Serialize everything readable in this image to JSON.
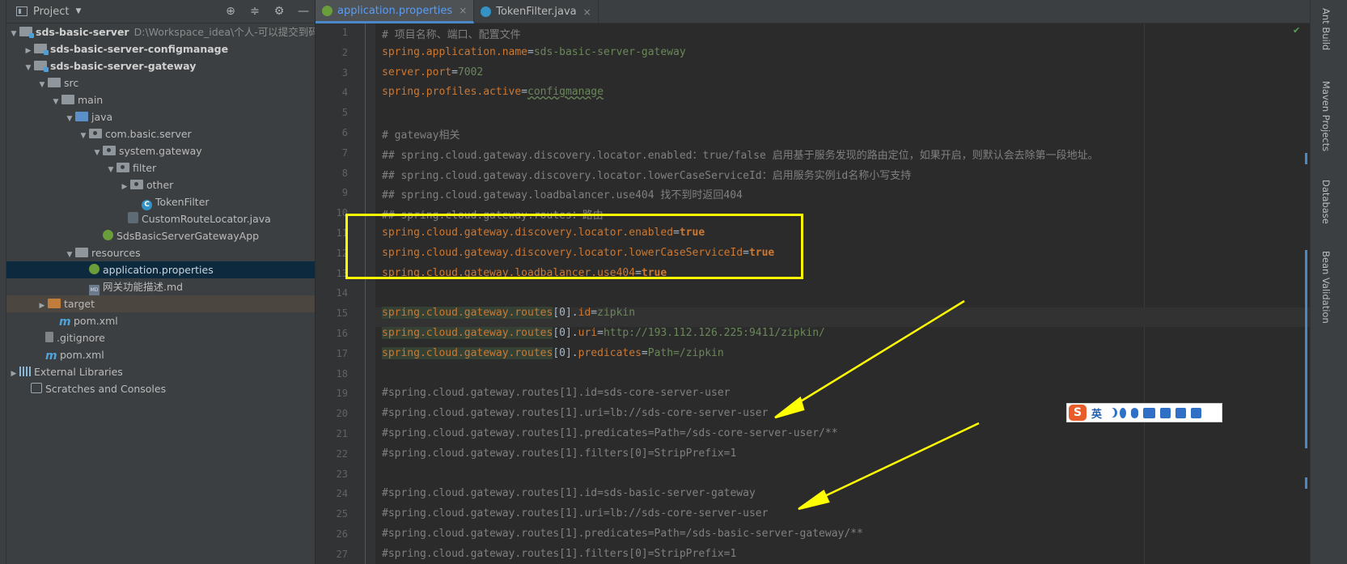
{
  "project_panel": {
    "title": "Project",
    "tree": [
      {
        "label": "sds-basic-server",
        "hint": "D:\\Workspace_idea\\个人-可以提交到码云的"
      },
      {
        "label": "sds-basic-server-configmanage"
      },
      {
        "label": "sds-basic-server-gateway"
      },
      {
        "label": "src"
      },
      {
        "label": "main"
      },
      {
        "label": "java"
      },
      {
        "label": "com.basic.server"
      },
      {
        "label": "system.gateway"
      },
      {
        "label": "filter"
      },
      {
        "label": "other"
      },
      {
        "label": "TokenFilter"
      },
      {
        "label": "CustomRouteLocator.java"
      },
      {
        "label": "SdsBasicServerGatewayApp"
      },
      {
        "label": "resources"
      },
      {
        "label": "application.properties"
      },
      {
        "label": "网关功能描述.md"
      },
      {
        "label": "target"
      },
      {
        "label": "pom.xml"
      },
      {
        "label": ".gitignore"
      },
      {
        "label": "pom.xml"
      },
      {
        "label": "External Libraries"
      },
      {
        "label": "Scratches and Consoles"
      }
    ]
  },
  "tabs": [
    {
      "label": "application.properties",
      "close": "×"
    },
    {
      "label": "TokenFilter.java",
      "close": "×"
    }
  ],
  "editor": {
    "line_numbers": [
      "1",
      "2",
      "3",
      "4",
      "5",
      "6",
      "7",
      "8",
      "9",
      "10",
      "11",
      "12",
      "13",
      "14",
      "15",
      "16",
      "17",
      "18",
      "19",
      "20",
      "21",
      "22",
      "23",
      "24",
      "25",
      "26",
      "27"
    ],
    "lines": [
      {
        "text": "# 项目名称、端口、配置文件"
      },
      {
        "key": "spring.application.name",
        "eq": "=",
        "val": "sds-basic-server-gateway"
      },
      {
        "key": "server.port",
        "eq": "=",
        "val": "7002"
      },
      {
        "key": "spring.profiles.active",
        "eq": "=",
        "val": "configmanage"
      },
      {
        "text": ""
      },
      {
        "text": "# gateway相关"
      },
      {
        "text": "## spring.cloud.gateway.discovery.locator.enabled：true/false 启用基于服务发现的路由定位，如果开启，则默认会去除第一段地址。"
      },
      {
        "text": "## spring.cloud.gateway.discovery.locator.lowerCaseServiceId：启用服务实例id名称小写支持"
      },
      {
        "text": "## spring.cloud.gateway.loadbalancer.use404 找不到时返回404"
      },
      {
        "text": "## spring.cloud.gateway.routes：路由"
      },
      {
        "key": "spring.cloud.gateway.discovery.locator.enabled",
        "eq": "=",
        "val": "true"
      },
      {
        "key": "spring.cloud.gateway.discovery.locator.lowerCaseServiceId",
        "eq": "=",
        "val": "true"
      },
      {
        "key": "spring.cloud.gateway.loadbalancer.use404",
        "eq": "=",
        "val": "true"
      },
      {
        "text": ""
      },
      {
        "key": "spring.cloud.gateway.routes",
        "idx": "[0].",
        "prop": "id",
        "eq": "=",
        "val": "zipkin"
      },
      {
        "key": "spring.cloud.gateway.routes",
        "idx": "[0].",
        "prop": "uri",
        "eq": "=",
        "val": "http://193.112.126.225:9411/zipkin/"
      },
      {
        "key": "spring.cloud.gateway.routes",
        "idx": "[0].",
        "prop": "predicates",
        "eq": "=",
        "val": "Path=/zipkin"
      },
      {
        "text": ""
      },
      {
        "text": "#spring.cloud.gateway.routes[1].id=sds-core-server-user"
      },
      {
        "text": "#spring.cloud.gateway.routes[1].uri=lb://sds-core-server-user"
      },
      {
        "text": "#spring.cloud.gateway.routes[1].predicates=Path=/sds-core-server-user/**"
      },
      {
        "text": "#spring.cloud.gateway.routes[1].filters[0]=StripPrefix=1"
      },
      {
        "text": ""
      },
      {
        "text": "#spring.cloud.gateway.routes[1].id=sds-basic-server-gateway"
      },
      {
        "text": "#spring.cloud.gateway.routes[1].uri=lb://sds-core-server-user"
      },
      {
        "text": "#spring.cloud.gateway.routes[1].predicates=Path=/sds-basic-server-gateway/**"
      },
      {
        "text": "#spring.cloud.gateway.routes[1].filters[0]=StripPrefix=1"
      }
    ]
  },
  "right_tools": [
    "Ant Build",
    "Maven Projects",
    "Database",
    "Bean Validation"
  ],
  "ime": {
    "logo": "S",
    "lang": "英"
  },
  "colors": {
    "key": "#cc7832",
    "value": "#6a8759",
    "comment": "#808080",
    "highlight_box": "#ffff00",
    "arrow": "#ffff00"
  }
}
